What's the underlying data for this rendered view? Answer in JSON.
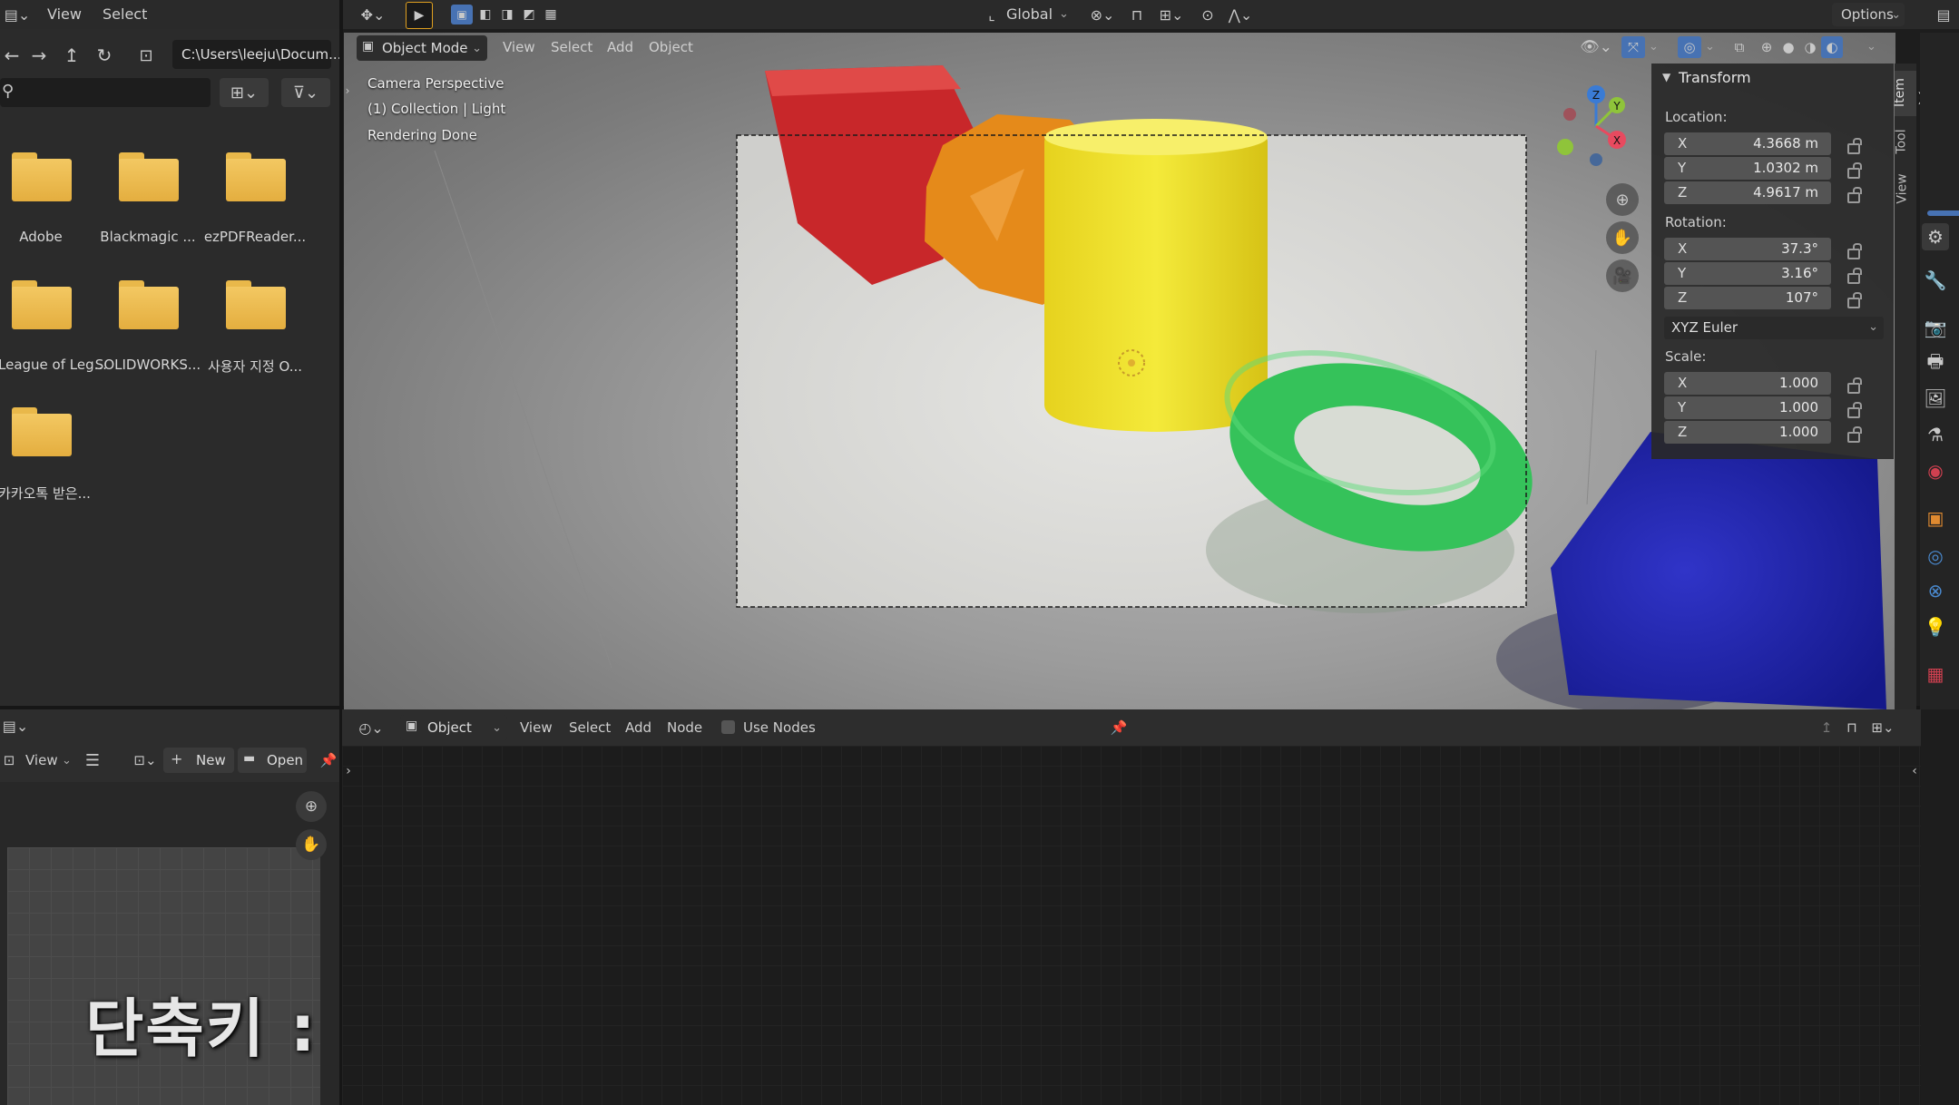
{
  "topbar": {
    "left_menus": [
      "View",
      "Select"
    ],
    "orientation": "Global",
    "options": "Options"
  },
  "file_browser": {
    "path": "C:\\Users\\leeju\\Docum...",
    "folders": [
      "Adobe",
      "Blackmagic ...",
      "ezPDFReader...",
      "League of Leg...",
      "SOLIDWORKS...",
      "사용자 지정 O...",
      "카카오톡 받은..."
    ]
  },
  "viewport": {
    "mode": "Object Mode",
    "menus": [
      "View",
      "Select",
      "Add",
      "Object"
    ],
    "info": {
      "line1": "Camera Perspective",
      "line2": "(1) Collection | Light",
      "line3": "Rendering Done"
    }
  },
  "npanel": {
    "title": "Transform",
    "location_label": "Location:",
    "location": {
      "x": "4.3668 m",
      "y": "1.0302 m",
      "z": "4.9617 m"
    },
    "rotation_label": "Rotation:",
    "rotation": {
      "x": "37.3°",
      "y": "3.16°",
      "z": "107°"
    },
    "rotation_mode": "XYZ Euler",
    "scale_label": "Scale:",
    "scale": {
      "x": "1.000",
      "y": "1.000",
      "z": "1.000"
    },
    "axis_labels": {
      "x": "X",
      "y": "Y",
      "z": "Z"
    },
    "tabs": [
      "Item",
      "Tool",
      "View"
    ]
  },
  "node_editor": {
    "type": "Object",
    "menus": [
      "View",
      "Select",
      "Add",
      "Node"
    ],
    "use_nodes": "Use Nodes"
  },
  "image_editor": {
    "view_label": "View",
    "new_label": "New",
    "open_label": "Open"
  },
  "overlay": {
    "shortcut_text": "단축키 : N"
  },
  "gizmo": {
    "x": "X",
    "y": "Y",
    "z": "Z"
  },
  "colors": {
    "accent_blue": "#4772b3",
    "axis_x": "#e84a5f",
    "axis_y": "#8fc43a",
    "axis_z": "#3a7bd5"
  }
}
